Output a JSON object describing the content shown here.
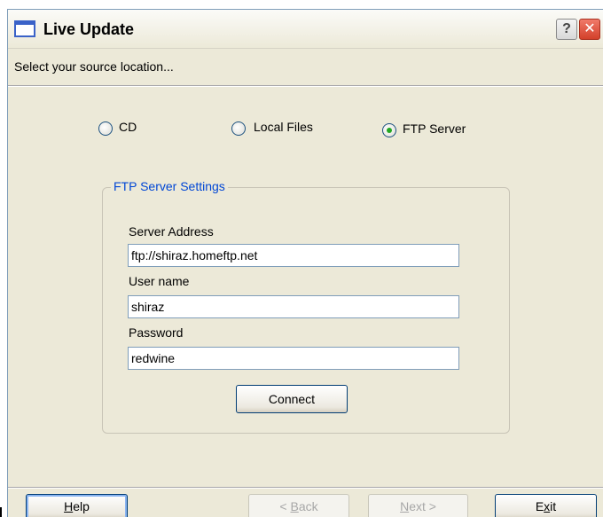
{
  "window": {
    "title": "Live Update",
    "help_glyph": "?",
    "close_glyph": "✕"
  },
  "subheader": "Select your source location...",
  "source_options": [
    {
      "label": "CD",
      "checked": false
    },
    {
      "label": "Local Files",
      "checked": false
    },
    {
      "label": "FTP Server",
      "checked": true
    }
  ],
  "ftp_settings": {
    "group_title": "FTP Server Settings",
    "server_address_label": "Server Address",
    "server_address_value": "ftp://shiraz.homeftp.net",
    "user_name_label": "User name",
    "user_name_value": "shiraz",
    "password_label": "Password",
    "password_value": "redwine",
    "connect_label": "Connect"
  },
  "footer": {
    "help_label_ul": "H",
    "help_label_rest": "elp",
    "back_prefix": "< ",
    "back_ul": "B",
    "back_rest": "ack",
    "next_ul": "N",
    "next_rest": "ext >",
    "exit_pre": "E",
    "exit_ul": "x",
    "exit_rest": "it"
  },
  "icons": {
    "window_icon": "window-icon",
    "help_icon": "question-icon",
    "close_icon": "close-icon"
  }
}
